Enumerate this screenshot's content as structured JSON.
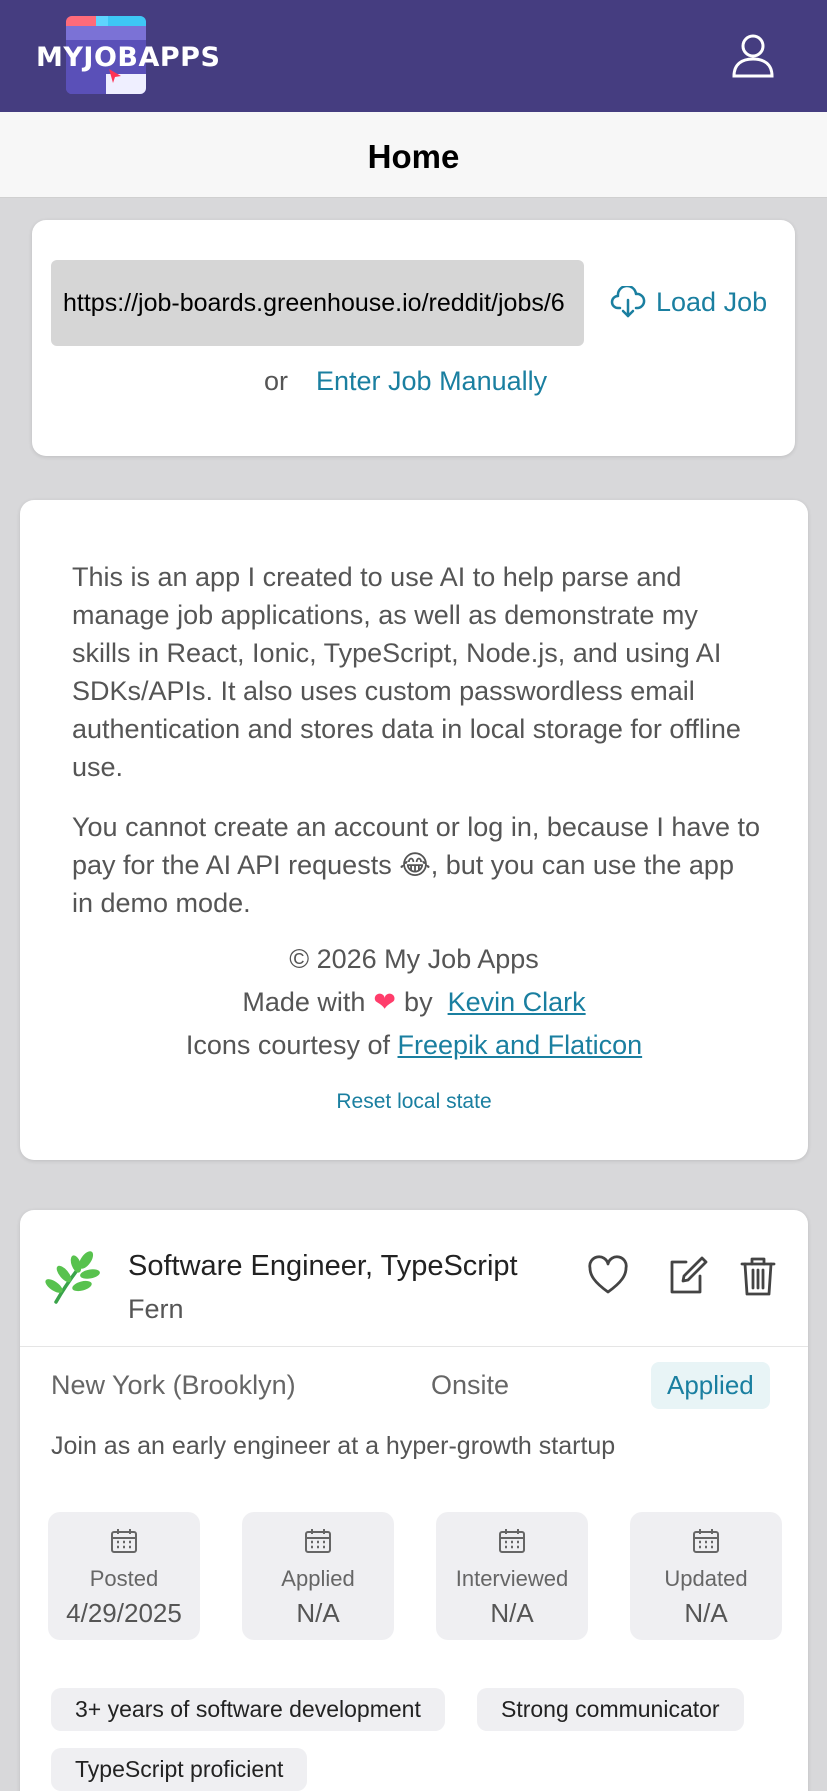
{
  "header": {
    "logo_text": "MYJOBAPPS",
    "user_icon": "user-icon"
  },
  "title_bar": {
    "title": "Home"
  },
  "load_job": {
    "url_value": "https://job-boards.greenhouse.io/reddit/jobs/6",
    "load_label": "Load Job",
    "load_icon": "cloud-download-icon",
    "or_text": "or",
    "manual_label": "Enter Job Manually"
  },
  "about": {
    "paragraph1": "This is an app I created to use AI to help parse and manage job applications, as well as demonstrate my skills in React, Ionic, TypeScript, Node.js, and using AI SDKs/APIs. It also uses custom passwordless email authentication and stores data in local storage for offline use.",
    "paragraph2": "You cannot create an account or log in, because I have to pay for the AI API requests 😂, but you can use the app in demo mode.",
    "copyright": "© 2026 My Job Apps",
    "made_with_prefix": "Made with",
    "made_with_heart": "❤",
    "made_with_by": "by",
    "author_link": "Kevin Clark",
    "icons_prefix": "Icons courtesy of",
    "icons_link": "Freepik and Flaticon",
    "reset_label": "Reset local state"
  },
  "job": {
    "title": "Software Engineer, TypeScript",
    "company": "Fern",
    "location": "New York (Brooklyn)",
    "work_mode": "Onsite",
    "status": "Applied",
    "summary": "Join as an early engineer at a hyper-growth startup",
    "dates": [
      {
        "label": "Posted",
        "value": "4/29/2025"
      },
      {
        "label": "Applied",
        "value": "N/A"
      },
      {
        "label": "Interviewed",
        "value": "N/A"
      },
      {
        "label": "Updated",
        "value": "N/A"
      }
    ],
    "tags": [
      "3+ years of software development",
      "Strong communicator",
      "TypeScript proficient"
    ]
  },
  "colors": {
    "header_bg": "#453d80",
    "link": "#1a7fa0",
    "status_bg": "#e8f4f6"
  }
}
